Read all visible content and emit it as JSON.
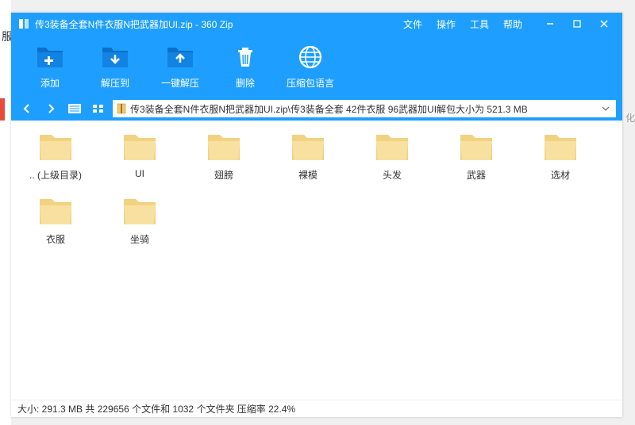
{
  "title": "传3装备全套N件衣服N把武器加UI.zip - 360 Zip",
  "menus": {
    "file": "文件",
    "operation": "操作",
    "tools": "工具",
    "help": "帮助"
  },
  "toolbar": {
    "add": "添加",
    "extract_to": "解压到",
    "one_click_extract": "一键解压",
    "delete": "删除",
    "archive_language": "压缩包语言"
  },
  "path": "传3装备全套N件衣服N把武器加UI.zip\\传3装备全套 42件衣服 96武器加UI解包大小为 521.3 MB",
  "items": [
    {
      "name": ".. (上级目录)"
    },
    {
      "name": "UI"
    },
    {
      "name": "翅膀"
    },
    {
      "name": "裸模"
    },
    {
      "name": "头发"
    },
    {
      "name": "武器"
    },
    {
      "name": "选材"
    },
    {
      "name": "衣服"
    },
    {
      "name": "坐骑"
    }
  ],
  "status": "大小: 291.3 MB 共 229656 个文件和 1032 个文件夹 压缩率 22.4%"
}
